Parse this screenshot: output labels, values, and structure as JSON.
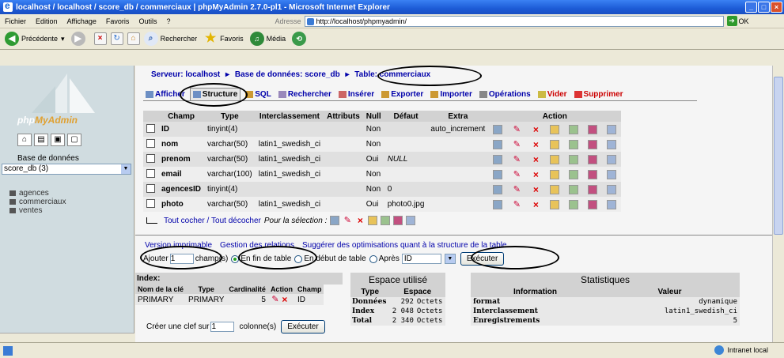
{
  "window": {
    "title": "localhost / localhost / score_db / commerciaux | phpMyAdmin 2.7.0-pl1 - Microsoft Internet Explorer"
  },
  "menu": [
    "Fichier",
    "Edition",
    "Affichage",
    "Favoris",
    "Outils",
    "?"
  ],
  "address": {
    "label": "Adresse",
    "value": "http://localhost/phpmyadmin/",
    "go": "OK"
  },
  "toolbar": {
    "back": "Précédente",
    "search": "Rechercher",
    "favorites": "Favoris",
    "media": "Média"
  },
  "sidebar": {
    "brand_a": "php",
    "brand_b": "MyAdmin",
    "db_label": "Base de données",
    "db_selected": "score_db (3)",
    "tables": [
      "agences",
      "commerciaux",
      "ventes"
    ]
  },
  "breadcrumb": {
    "server": "Serveur: localhost",
    "database": "Base de données: score_db",
    "table": "Table: commerciaux"
  },
  "tabs": [
    {
      "label": "Afficher"
    },
    {
      "label": "Structure"
    },
    {
      "label": "SQL"
    },
    {
      "label": "Rechercher"
    },
    {
      "label": "Insérer"
    },
    {
      "label": "Exporter"
    },
    {
      "label": "Importer"
    },
    {
      "label": "Opérations"
    },
    {
      "label": "Vider"
    },
    {
      "label": "Supprimer"
    }
  ],
  "structure": {
    "headers": [
      "Champ",
      "Type",
      "Interclassement",
      "Attributs",
      "Null",
      "Défaut",
      "Extra",
      "Action"
    ],
    "rows": [
      {
        "champ": "ID",
        "type": "tinyint(4)",
        "inter": "",
        "attr": "",
        "null": "Non",
        "defaut": "",
        "extra": "auto_increment"
      },
      {
        "champ": "nom",
        "type": "varchar(50)",
        "inter": "latin1_swedish_ci",
        "attr": "",
        "null": "Non",
        "defaut": "",
        "extra": ""
      },
      {
        "champ": "prenom",
        "type": "varchar(50)",
        "inter": "latin1_swedish_ci",
        "attr": "",
        "null": "Oui",
        "defaut": "NULL",
        "extra": ""
      },
      {
        "champ": "email",
        "type": "varchar(100)",
        "inter": "latin1_swedish_ci",
        "attr": "",
        "null": "Non",
        "defaut": "",
        "extra": ""
      },
      {
        "champ": "agencesID",
        "type": "tinyint(4)",
        "inter": "",
        "attr": "",
        "null": "Non",
        "defaut": "0",
        "extra": ""
      },
      {
        "champ": "photo",
        "type": "varchar(50)",
        "inter": "latin1_swedish_ci",
        "attr": "",
        "null": "Oui",
        "defaut": "photo0.jpg",
        "extra": ""
      }
    ]
  },
  "selection": {
    "check_all": "Tout cocher",
    "separator": " / ",
    "uncheck_all": "Tout décocher",
    "for_selection": "Pour la sélection :"
  },
  "links": {
    "print": "Version imprimable",
    "relations": "Gestion des relations",
    "suggest": "Suggérer des optimisations quant à la structure de la table"
  },
  "add_field": {
    "label": "Ajouter",
    "value": "1",
    "fields": "champ(s)",
    "end": "En fin de table",
    "start": "En début de table",
    "after": "Après",
    "after_value": "ID",
    "execute": "Exécuter"
  },
  "index": {
    "title": "Index:",
    "headers": [
      "Nom de la clé",
      "Type",
      "Cardinalité",
      "Action",
      "Champ"
    ],
    "rows": [
      {
        "name": "PRIMARY",
        "type": "PRIMARY",
        "card": "5",
        "champ": "ID"
      }
    ],
    "create_label": "Créer une clef sur",
    "create_value": "1",
    "columns": "colonne(s)",
    "execute": "Exécuter"
  },
  "space": {
    "title": "Espace utilisé",
    "headers": [
      "Type",
      "Espace"
    ],
    "rows": [
      {
        "type": "Données",
        "value": "292",
        "unit": "Octets"
      },
      {
        "type": "Index",
        "value": "2 048",
        "unit": "Octets"
      },
      {
        "type": "Total",
        "value": "2 340",
        "unit": "Octets"
      }
    ]
  },
  "stats": {
    "title": "Statistiques",
    "headers": [
      "Information",
      "Valeur"
    ],
    "rows": [
      {
        "info": "format",
        "value": "dynamique"
      },
      {
        "info": "Interclassement",
        "value": "latin1_swedish_ci"
      },
      {
        "info": "Enregistrements",
        "value": "5"
      }
    ]
  },
  "status": {
    "zone": "Intranet local"
  }
}
